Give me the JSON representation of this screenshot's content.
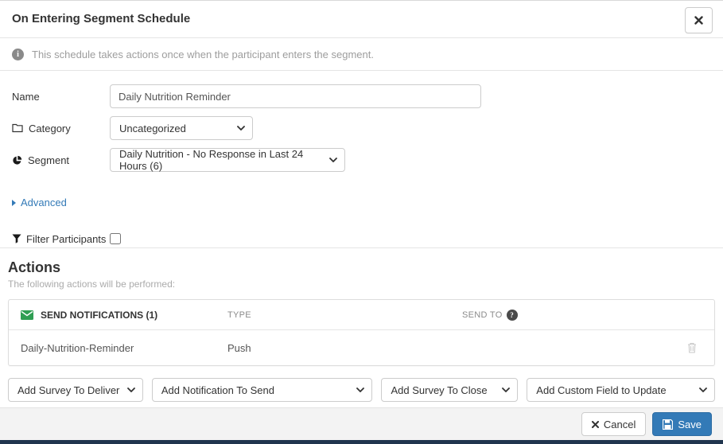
{
  "modal": {
    "title": "On Entering Segment Schedule",
    "info_text": "This schedule takes actions once when the participant enters the segment.",
    "form": {
      "name_label": "Name",
      "name_value": "Daily Nutrition Reminder",
      "category_label": "Category",
      "category_value": "Uncategorized",
      "segment_label": "Segment",
      "segment_value": "Daily Nutrition - No Response in Last 24 Hours (6)",
      "advanced_label": "Advanced",
      "filter_label": "Filter Participants"
    },
    "actions": {
      "heading": "Actions",
      "subheading": "The following actions will be performed:",
      "table": {
        "columns": [
          "SEND NOTIFICATIONS (1)",
          "TYPE",
          "SEND TO"
        ],
        "rows": [
          {
            "name": "Daily-Nutrition-Reminder",
            "type": "Push",
            "send_to": ""
          }
        ]
      },
      "add_dropdowns": [
        "Add Survey To Deliver",
        "Add Notification To Send",
        "Add Survey To Close",
        "Add Custom Field to Update"
      ]
    },
    "footer": {
      "cancel_label": "Cancel",
      "save_label": "Save"
    }
  },
  "icons": {
    "info_glyph": "i",
    "question_glyph": "?"
  },
  "colors": {
    "primary_blue": "#337ab7",
    "envelope_green": "#2f9e53",
    "bottom_bar_navy": "#20354e"
  }
}
